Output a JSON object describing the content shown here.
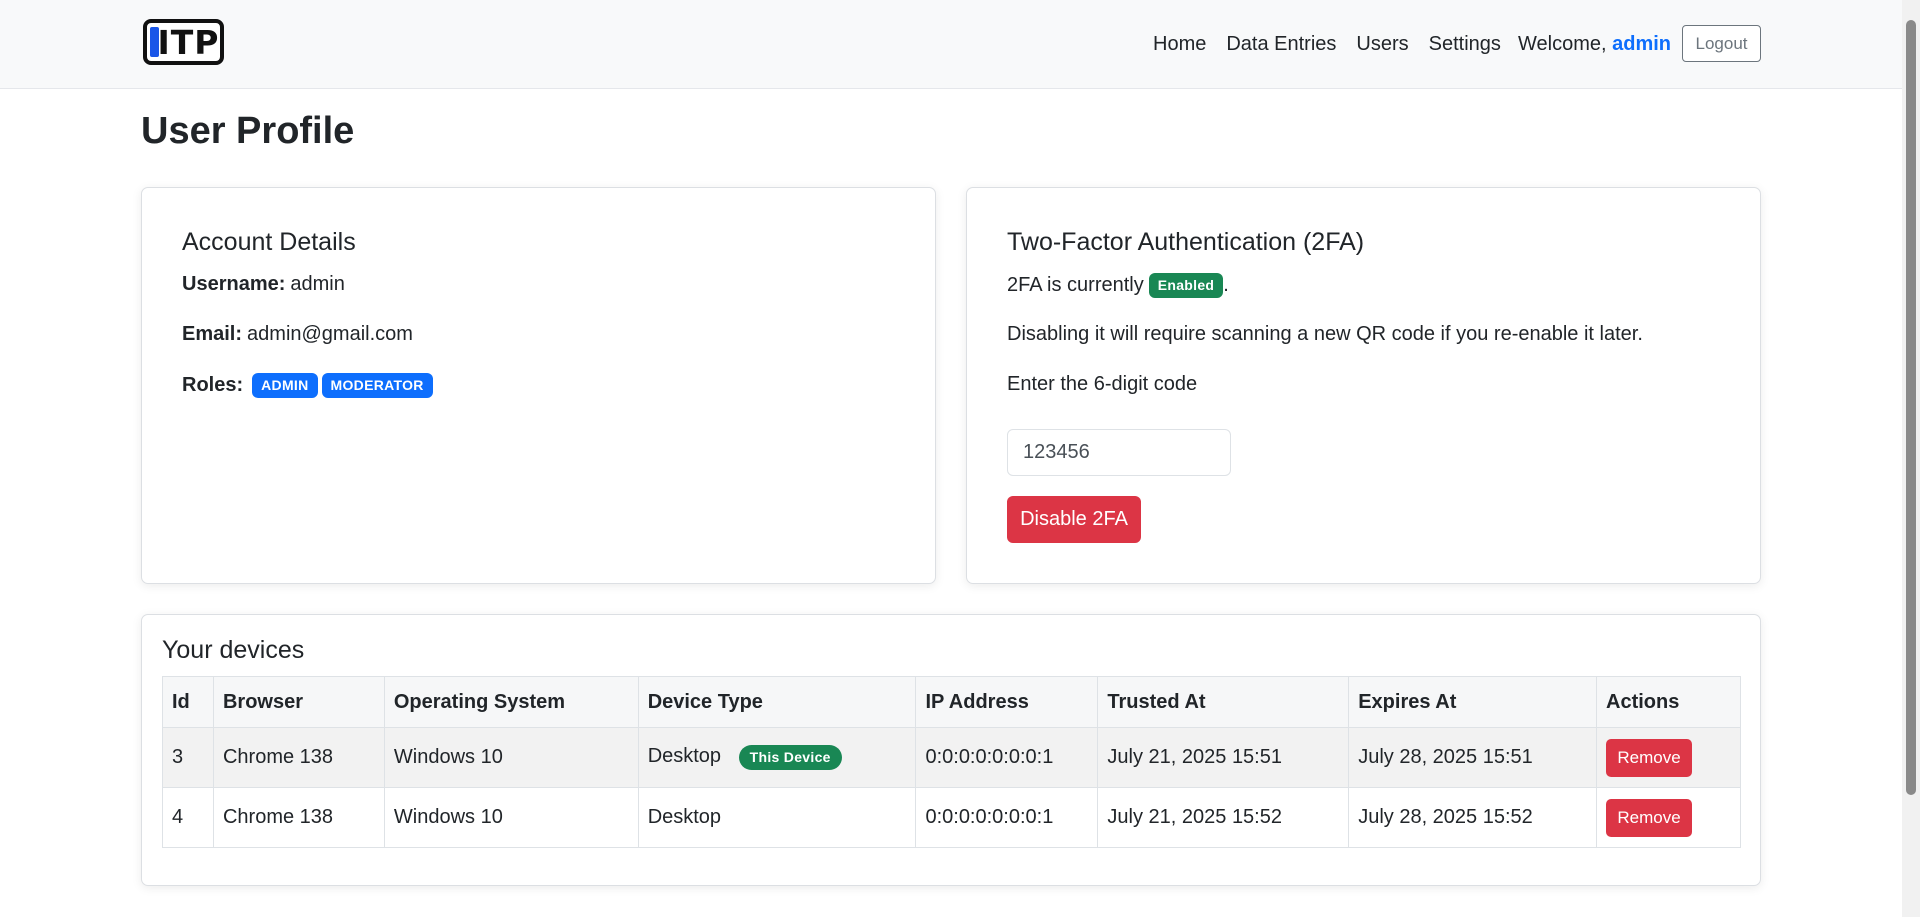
{
  "nav": {
    "logo_text": "ITP",
    "links": [
      "Home",
      "Data Entries",
      "Users",
      "Settings"
    ],
    "welcome_prefix": "Welcome,",
    "username": "admin",
    "logout_label": "Logout"
  },
  "page": {
    "title": "User Profile"
  },
  "account": {
    "title": "Account Details",
    "username_label": "Username:",
    "username_value": "admin",
    "email_label": "Email:",
    "email_value": "admin@gmail.com",
    "roles_label": "Roles:",
    "roles": [
      "ADMIN",
      "MODERATOR"
    ]
  },
  "twofa": {
    "title": "Two-Factor Authentication (2FA)",
    "status_prefix": "2FA is currently",
    "status_badge": "Enabled",
    "status_suffix": ".",
    "warning": "Disabling it will require scanning a new QR code if you re-enable it later.",
    "code_label": "Enter the 6-digit code",
    "code_value": "123456",
    "disable_label": "Disable 2FA"
  },
  "devices": {
    "title": "Your devices",
    "columns": [
      "Id",
      "Browser",
      "Operating System",
      "Device Type",
      "IP Address",
      "Trusted At",
      "Expires At",
      "Actions"
    ],
    "rows": [
      {
        "id": "3",
        "browser": "Chrome 138",
        "os": "Windows 10",
        "device_type": "Desktop",
        "badge": "This Device",
        "ip": "0:0:0:0:0:0:0:1",
        "trusted_at": "July 21, 2025 15:51",
        "expires_at": "July 28, 2025 15:51",
        "action": "Remove"
      },
      {
        "id": "4",
        "browser": "Chrome 138",
        "os": "Windows 10",
        "device_type": "Desktop",
        "badge": "",
        "ip": "0:0:0:0:0:0:0:1",
        "trusted_at": "July 21, 2025 15:52",
        "expires_at": "July 28, 2025 15:52",
        "action": "Remove"
      }
    ]
  },
  "colors": {
    "primary": "#0d6efd",
    "success": "#198754",
    "danger": "#dc3545",
    "navbar_bg": "#f8f9fa"
  }
}
